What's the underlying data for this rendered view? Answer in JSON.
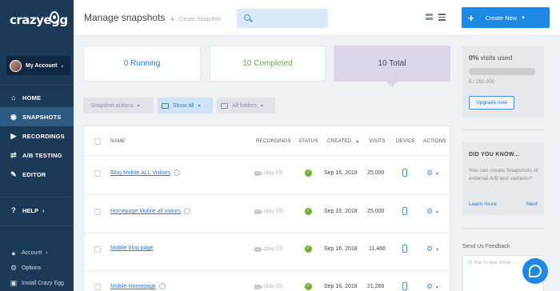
{
  "brand": {
    "logo_text": "crazyegg"
  },
  "account": {
    "label": "My Account",
    "chevron": "›"
  },
  "nav": [
    {
      "label": "HOME",
      "icon": "home-icon",
      "glyph": "⌂",
      "active": false
    },
    {
      "label": "SNAPSHOTS",
      "icon": "camera-icon",
      "glyph": "◉",
      "active": true
    },
    {
      "label": "RECORDINGS",
      "icon": "video-icon",
      "glyph": "▶",
      "active": false
    },
    {
      "label": "A/B TESTING",
      "icon": "ab-test-icon",
      "glyph": "⇄",
      "active": false
    },
    {
      "label": "EDITOR",
      "icon": "pencil-icon",
      "glyph": "✎",
      "active": false
    }
  ],
  "help": {
    "label": "HELP",
    "chevron": "›"
  },
  "bottom_links": [
    {
      "label": "Account",
      "icon": "user-icon",
      "glyph": "●",
      "chevron": "›"
    },
    {
      "label": "Options",
      "icon": "gear-icon",
      "glyph": "⚙",
      "chevron": ""
    },
    {
      "label": "Install Crazy Egg",
      "icon": "code-icon",
      "glyph": "▣",
      "chevron": ""
    }
  ],
  "header": {
    "title": "Manage snapshots",
    "create_snapshot": "Create Snapshot",
    "create_new": "Create New",
    "search_placeholder": ""
  },
  "stats": {
    "running": "0 Running",
    "completed": "10 Completed",
    "total": "10 Total"
  },
  "filters": {
    "actions": "Snapshot actions",
    "show": "Show all",
    "folders": "All folders"
  },
  "table": {
    "columns": {
      "name": "NAME",
      "recordings": "RECORDINGS",
      "status": "STATUS",
      "created": "CREATED",
      "visits": "VISITS",
      "device": "DEVICE",
      "actions": "ACTIONS"
    },
    "sort_indicator": "▲",
    "rows": [
      {
        "name": "Blog Mobile ALL Visitors",
        "recordings": "play (0)",
        "created": "Sep 16, 2018",
        "visits": "25,000"
      },
      {
        "name": "Homepage Mobile all vsitors",
        "recordings": "play (0)",
        "created": "Sep 16, 2018",
        "visits": "25,000"
      },
      {
        "name": "Mobile blog page",
        "recordings": "play (0)",
        "created": "Sep 16, 2018",
        "visits": "11,466"
      },
      {
        "name": "Mobile Homepage",
        "recordings": "play (0)",
        "created": "Sep 16, 2018",
        "visits": "21,266"
      }
    ]
  },
  "usage": {
    "percent_text": "0%",
    "visits_used_label": "visits used",
    "fraction_used": 0,
    "count_text": "0 / 250,000",
    "upgrade_label": "Upgrade now"
  },
  "did_you_know": {
    "title": "DID YOU KNOW...",
    "text": "You can create Snapshots of external A/B test variants?",
    "learn_more": "Learn more",
    "next": "Next"
  },
  "feedback": {
    "title": "Send Us Feedback",
    "placeholder": "I'd like to see more..."
  },
  "colors": {
    "sidebar": "#1b3a57",
    "accent": "#1e88e5",
    "running": "#2e7bcf",
    "completed": "#6aa84f",
    "total_bg": "#dcd4e8",
    "status_ok": "#6bb32e"
  }
}
